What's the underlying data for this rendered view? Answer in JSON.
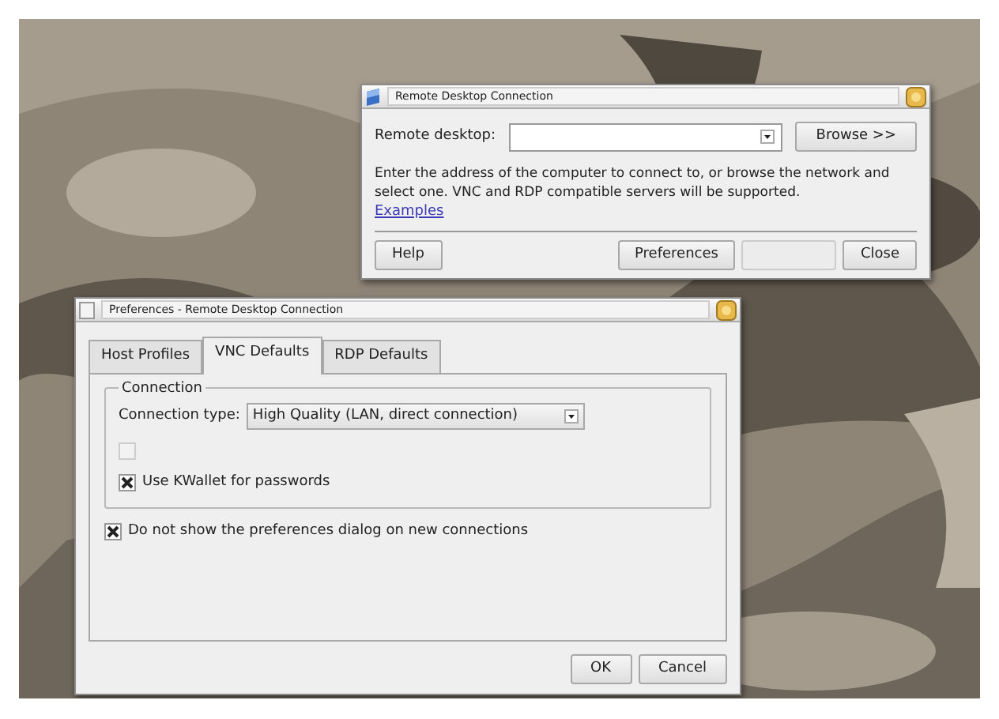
{
  "main_window": {
    "title": "Remote Desktop Connection",
    "field_label": "Remote desktop:",
    "browse_button": "Browse >>",
    "description": "Enter the address of the computer to connect to, or browse the network and select one. VNC and RDP compatible servers will be supported.",
    "link": "Examples",
    "buttons": [
      {
        "label": "Help",
        "disabled": false
      },
      {
        "label": "Preferences",
        "disabled": false
      },
      {
        "disabled": true
      },
      {
        "label": "Close",
        "disabled": false
      }
    ]
  },
  "preferences_window": {
    "title": "Preferences - Remote Desktop Connection",
    "tabs": [
      {
        "label": "Host Profiles",
        "selected": false
      },
      {
        "label": "VNC Defaults",
        "selected": true
      },
      {
        "label": "RDP Defaults",
        "selected": false
      }
    ],
    "group_title": "Connection",
    "connection_type_label": "Connection type:",
    "connection_type_value": "High Quality (LAN, direct connection)",
    "group_checkboxes": [
      {
        "checked": false,
        "disabled": true
      },
      {
        "label": "Use KWallet for passwords",
        "checked": true,
        "disabled": false
      }
    ],
    "checkbox": {
      "label": "Do not show the preferences dialog on new connections",
      "checked": true
    },
    "buttons": [
      {
        "label": "OK"
      },
      {
        "label": "Cancel"
      }
    ]
  }
}
